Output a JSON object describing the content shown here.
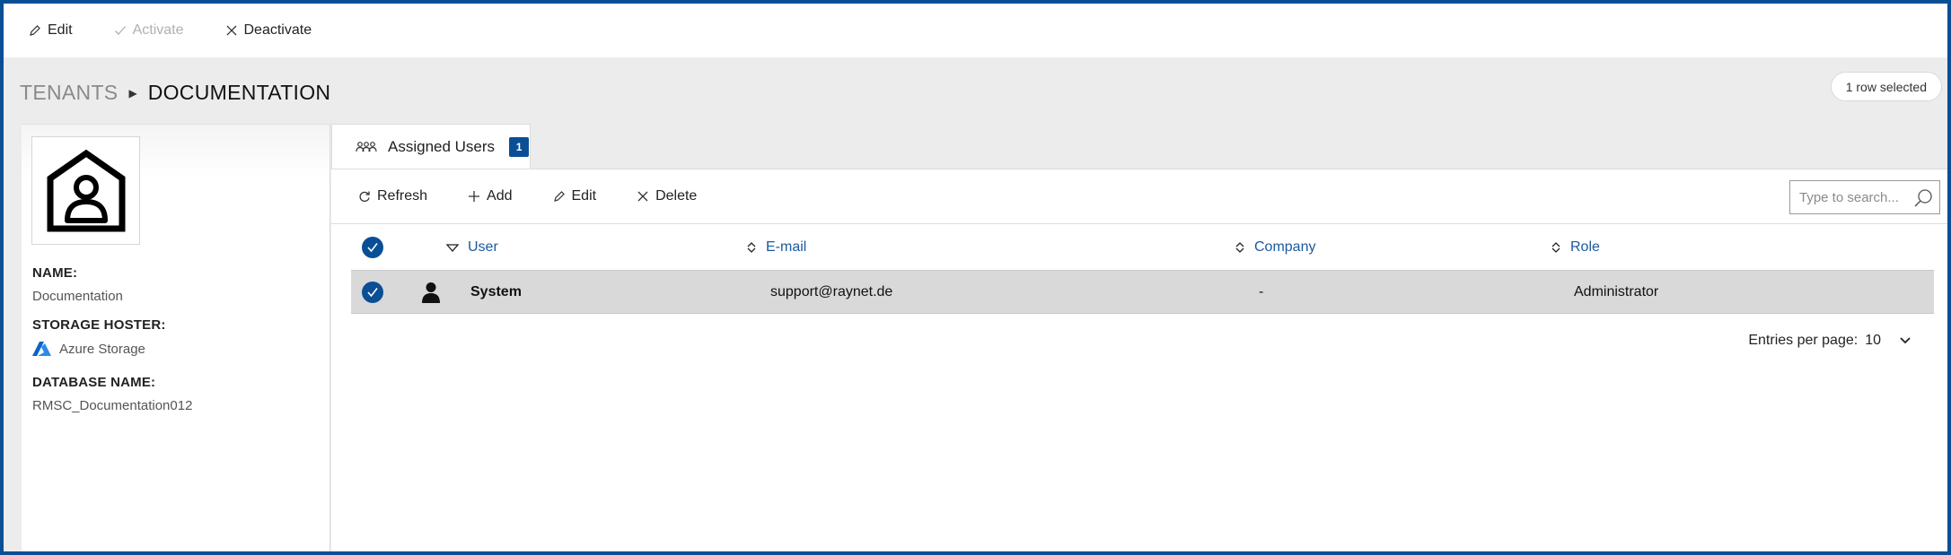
{
  "actions": {
    "edit": "Edit",
    "activate": "Activate",
    "deactivate": "Deactivate"
  },
  "breadcrumb": {
    "parent": "TENANTS",
    "current": "DOCUMENTATION"
  },
  "selection_badge": "1 row selected",
  "tenant": {
    "name_label": "NAME:",
    "name_value": "Documentation",
    "storage_label": "STORAGE HOSTER:",
    "storage_value": "Azure Storage",
    "database_label": "DATABASE NAME:",
    "database_value": "RMSC_Documentation012"
  },
  "tab": {
    "label": "Assigned Users",
    "count": "1"
  },
  "toolbar": {
    "refresh": "Refresh",
    "add": "Add",
    "edit": "Edit",
    "delete": "Delete",
    "search_placeholder": "Type to search..."
  },
  "table": {
    "columns": [
      "User",
      "E-mail",
      "Company",
      "Role"
    ],
    "rows": [
      {
        "user": "System",
        "email": "support@raynet.de",
        "company": "-",
        "role": "Administrator",
        "selected": true
      }
    ]
  },
  "pager": {
    "label": "Entries per page:",
    "value": "10"
  },
  "colors": {
    "accent": "#0a4f95",
    "link": "#1b5aa0",
    "selected_row": "#d9d9d9"
  }
}
